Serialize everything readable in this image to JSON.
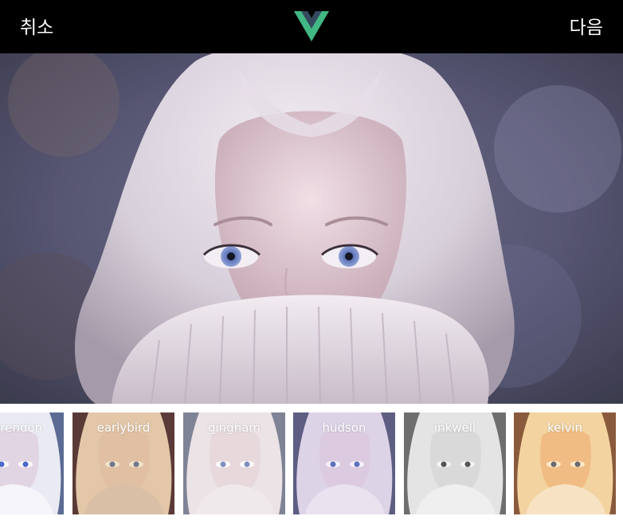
{
  "header": {
    "cancel_label": "취소",
    "next_label": "다음",
    "logo": "vue-logo-icon",
    "logo_colors": {
      "outer": "#41b883",
      "inner": "#35495e"
    }
  },
  "photo": {
    "alt": "woman with light blonde hair covering her face with a knit sweater collar"
  },
  "filters": [
    {
      "name": "clarendon",
      "label": "clarendon"
    },
    {
      "name": "earlybird",
      "label": "earlybird"
    },
    {
      "name": "gingham",
      "label": "gingham"
    },
    {
      "name": "hudson",
      "label": "hudson"
    },
    {
      "name": "inkwell",
      "label": "inkwell"
    },
    {
      "name": "kelvin",
      "label": "kelvin"
    }
  ]
}
